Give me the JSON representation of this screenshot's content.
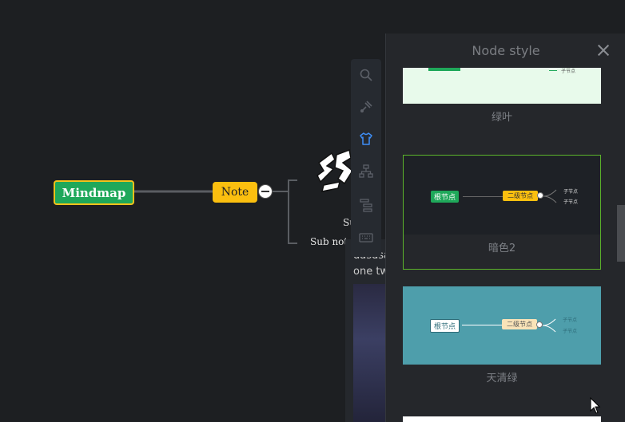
{
  "mindmap": {
    "root": "Mindmap",
    "note_node": "Note",
    "sub_label_1": "Su",
    "sub_label_2": "Sub note"
  },
  "note_panel": {
    "line1": "dasdsa",
    "line2": "one tw"
  },
  "toolbar": {
    "tools": [
      "search-icon",
      "brush-icon",
      "shirt-icon",
      "structure-icon",
      "outline-icon",
      "keyboard-icon"
    ],
    "active_tool": "shirt-icon"
  },
  "sidebar": {
    "title": "Node style",
    "themes": [
      {
        "name": "绿叶",
        "bg": "#e8faeb"
      },
      {
        "name": "暗色2",
        "bg": "#1e2126",
        "root": "根节点",
        "second": "二级节点",
        "child1": "子节点",
        "child2": "子节点",
        "selected": true
      },
      {
        "name": "天清绿",
        "bg": "#4e9eab",
        "root": "根节点",
        "second": "二级节点",
        "child1": "子节点",
        "child2": "子节点"
      }
    ],
    "preview_children_top": [
      "子节点"
    ]
  },
  "colors": {
    "background": "#1d1f22",
    "root_fill": "#1fa85a",
    "root_border": "#f3c21b",
    "note_fill": "#fbbf0f",
    "accent": "#3e8ef7",
    "selected_border": "#5cb42b"
  }
}
